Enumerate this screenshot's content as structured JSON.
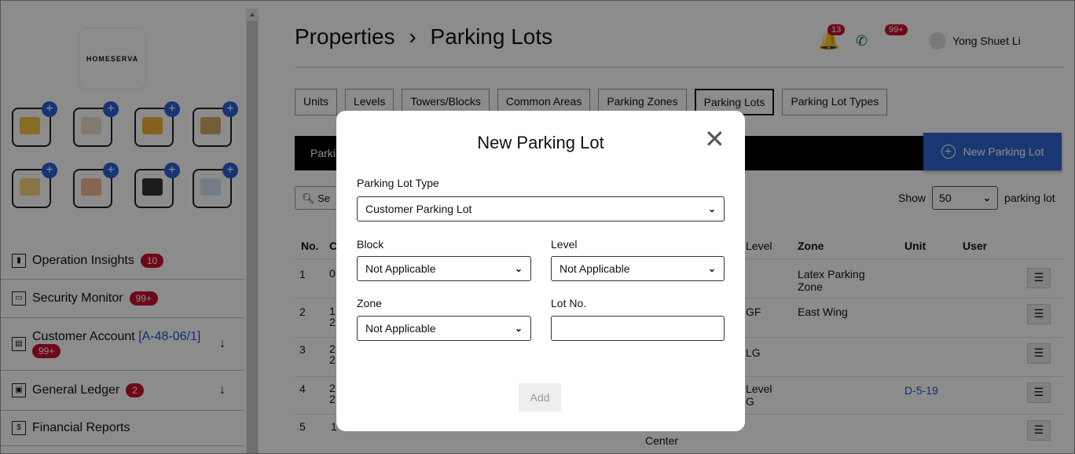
{
  "sidebar": {
    "logo_text": "HOMESERVA",
    "nav": [
      {
        "label": "Operation Insights",
        "badge": "10",
        "icon": "chart-icon"
      },
      {
        "label": "Security Monitor",
        "badge": "99+",
        "icon": "monitor-icon"
      },
      {
        "label": "Customer Account",
        "link": "[A-48-06/1]",
        "badge": "99+",
        "icon": "account-icon",
        "arrow": "↓"
      },
      {
        "label": "General Ledger",
        "badge": "2",
        "icon": "ledger-icon",
        "arrow": "↓"
      },
      {
        "label": "Financial Reports",
        "icon": "report-icon"
      }
    ]
  },
  "header": {
    "title": "Properties",
    "separator": "›",
    "subtitle": "Parking Lots",
    "notif_count": "13",
    "chat_count": "99+",
    "user": "Yong Shuet Li"
  },
  "tabs": [
    "Units",
    "Levels",
    "Towers/Blocks",
    "Common Areas",
    "Parking Zones",
    "Parking Lots",
    "Parking Lot Types"
  ],
  "active_tab": "Parking Lots",
  "bar_text": "Parki",
  "new_button": "New Parking Lot",
  "search_placeholder": "Se",
  "show": {
    "label": "Show",
    "value": "50",
    "suffix": "parking lot"
  },
  "table": {
    "headers": {
      "no": "No.",
      "c": "C",
      "level": "Level",
      "zone": "Zone",
      "unit": "Unit",
      "user": "User"
    },
    "rows": [
      {
        "no": "1",
        "c": "0",
        "level": "",
        "zone": "Latex Parking\nZone",
        "unit": "",
        "extra": ""
      },
      {
        "no": "2",
        "c": "1\n2",
        "level": "GF",
        "zone": "East Wing",
        "unit": "",
        "extra": ""
      },
      {
        "no": "3",
        "c": "2\n2",
        "level": "LG",
        "zone": "",
        "unit": "",
        "extra": ""
      },
      {
        "no": "4",
        "c": "2\n2",
        "level": "Level\nG",
        "zone": "",
        "unit": "D-5-19",
        "extra": ""
      },
      {
        "no": "5",
        "c": "1",
        "level": "",
        "zone": "",
        "unit": "",
        "extra": "Center"
      }
    ],
    "menu_glyph": "☰"
  },
  "modal": {
    "title": "New Parking Lot",
    "close": "✕",
    "type_label": "Parking Lot Type",
    "type_value": "Customer Parking Lot",
    "block_label": "Block",
    "block_value": "Not Applicable",
    "level_label": "Level",
    "level_value": "Not Applicable",
    "zone_label": "Zone",
    "zone_value": "Not Applicable",
    "lot_label": "Lot No.",
    "lot_value": "",
    "add_label": "Add"
  },
  "colors": {
    "accent": "#2f66d0",
    "badge": "#c8102e",
    "app_plus": "#2a5fd6"
  }
}
